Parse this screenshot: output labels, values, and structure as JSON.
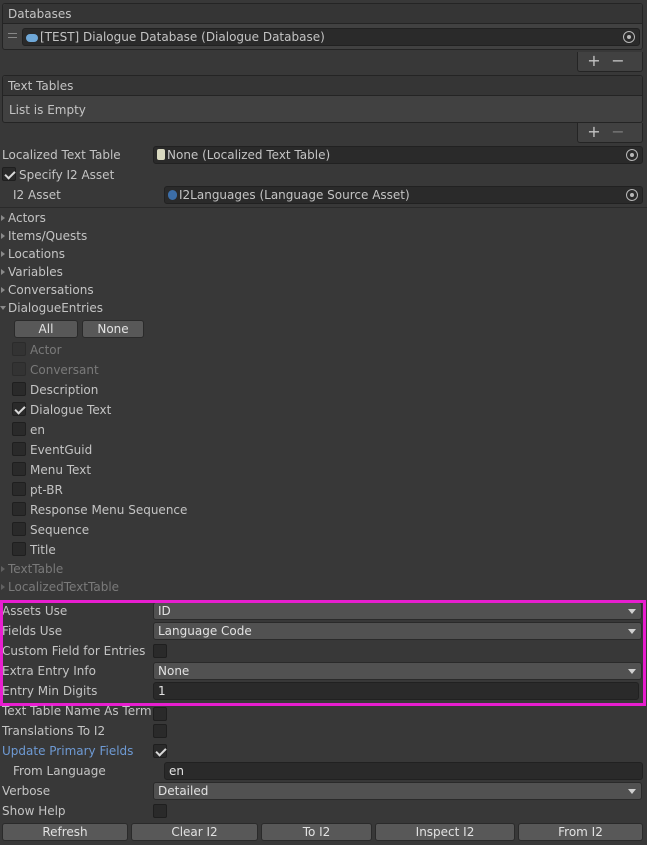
{
  "databases": {
    "header": "Databases",
    "items": [
      {
        "label": "[TEST] Dialogue Database (Dialogue Database)"
      }
    ],
    "add": "+",
    "remove": "−"
  },
  "text_tables": {
    "header": "Text Tables",
    "empty_text": "List is Empty",
    "add": "+",
    "remove": "−"
  },
  "localized_text_table": {
    "label": "Localized Text Table",
    "value": "None (Localized Text Table)"
  },
  "specify_i2_asset": {
    "label": "Specify I2 Asset",
    "checked": true
  },
  "i2_asset": {
    "label": "I2 Asset",
    "value": "I2Languages (Language Source Asset)"
  },
  "foldouts": {
    "actors": "Actors",
    "items_quests": "Items/Quests",
    "locations": "Locations",
    "variables": "Variables",
    "conversations": "Conversations",
    "dialogue_entries": "DialogueEntries",
    "text_table": "TextTable",
    "localized_text_table": "LocalizedTextTable"
  },
  "entry_buttons": {
    "all": "All",
    "none": "None"
  },
  "entry_fields": [
    {
      "label": "Actor",
      "checked": false,
      "disabled": true
    },
    {
      "label": "Conversant",
      "checked": false,
      "disabled": true
    },
    {
      "label": "Description",
      "checked": false,
      "disabled": false
    },
    {
      "label": "Dialogue Text",
      "checked": true,
      "disabled": false
    },
    {
      "label": "en",
      "checked": false,
      "disabled": false
    },
    {
      "label": "EventGuid",
      "checked": false,
      "disabled": false
    },
    {
      "label": "Menu Text",
      "checked": false,
      "disabled": false
    },
    {
      "label": "pt-BR",
      "checked": false,
      "disabled": false
    },
    {
      "label": "Response Menu Sequence",
      "checked": false,
      "disabled": false
    },
    {
      "label": "Sequence",
      "checked": false,
      "disabled": false
    },
    {
      "label": "Title",
      "checked": false,
      "disabled": false
    }
  ],
  "settings": {
    "assets_use": {
      "label": "Assets Use",
      "value": "ID"
    },
    "fields_use": {
      "label": "Fields Use",
      "value": "Language Code"
    },
    "custom_field_for_entries": {
      "label": "Custom Field for Entries",
      "checked": false
    },
    "extra_entry_info": {
      "label": "Extra Entry Info",
      "value": "None"
    },
    "entry_min_digits": {
      "label": "Entry Min Digits",
      "value": "1"
    },
    "text_table_name_as_term": {
      "label": "Text Table Name As Term",
      "checked": false
    },
    "translations_to_i2": {
      "label": "Translations To I2",
      "checked": false
    },
    "update_primary_fields": {
      "label": "Update Primary Fields",
      "checked": true
    },
    "from_language": {
      "label": "From Language",
      "value": "en"
    },
    "verbose": {
      "label": "Verbose",
      "value": "Detailed"
    },
    "show_help": {
      "label": "Show Help",
      "checked": false
    }
  },
  "actions": {
    "refresh": "Refresh",
    "clear_i2": "Clear I2",
    "to_i2": "To I2",
    "inspect_i2": "Inspect I2",
    "from_i2": "From I2"
  },
  "colors": {
    "background": "#383838",
    "highlight": "#e81ed0",
    "link_blue": "#6e9ad4"
  }
}
